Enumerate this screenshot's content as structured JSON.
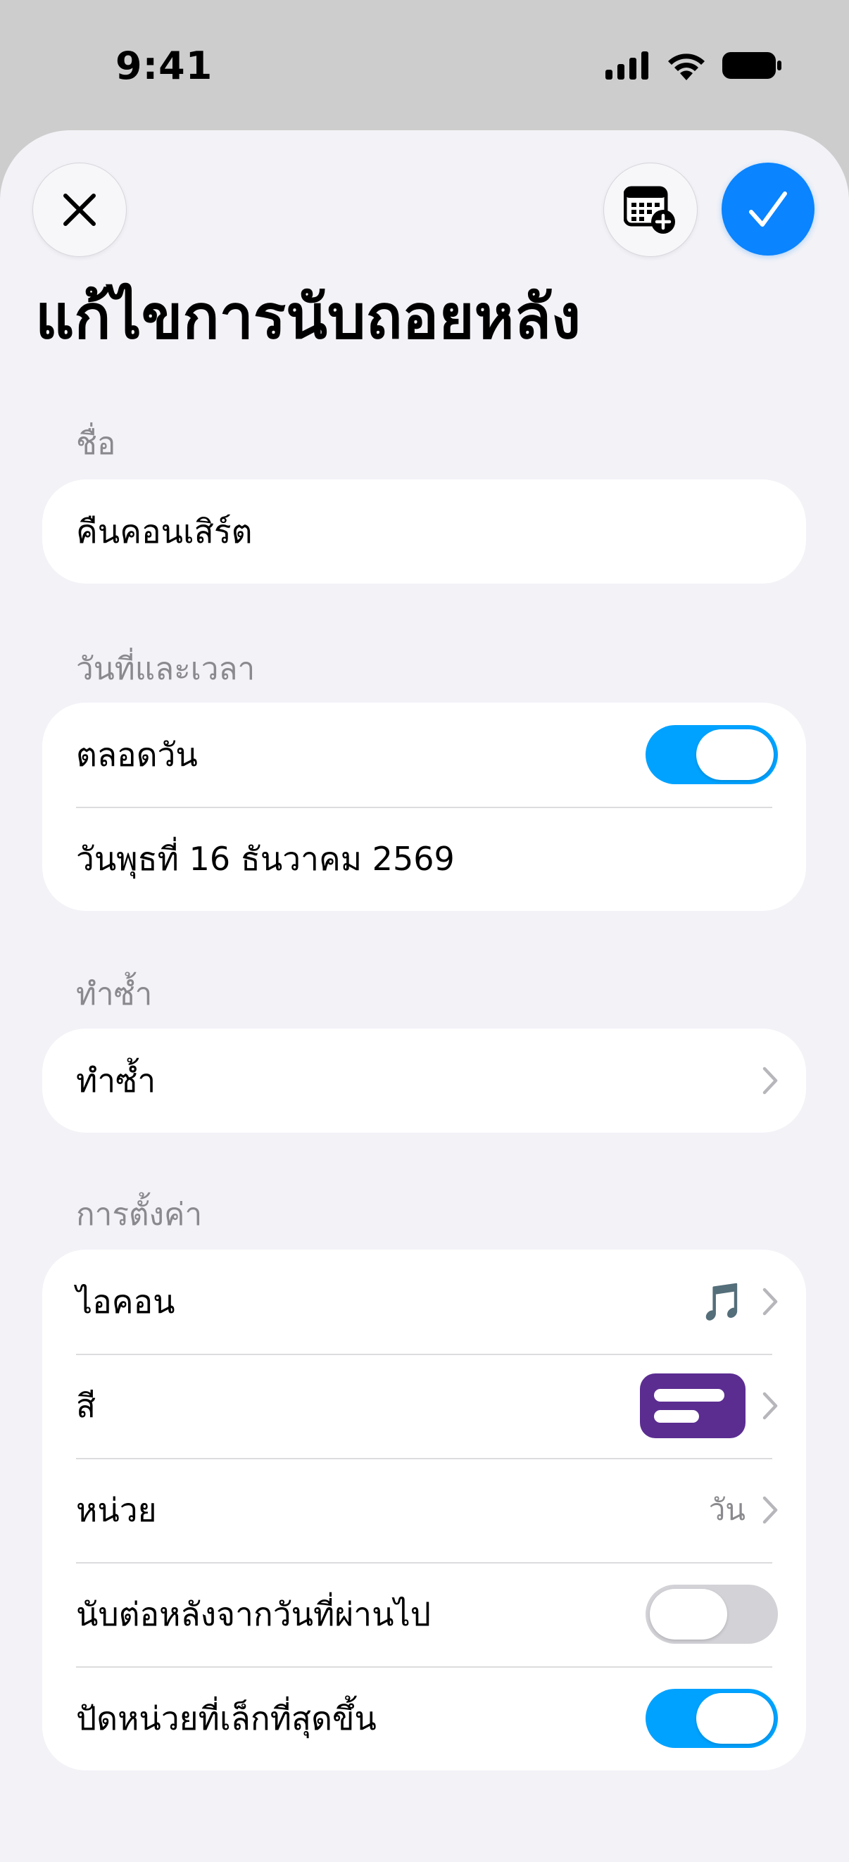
{
  "status_bar": {
    "time": "9:41"
  },
  "header": {
    "title": "แก้ไขการนับถอยหลัง"
  },
  "sections": {
    "name": {
      "label": "ชื่อ",
      "value": "คืนคอนเสิร์ต"
    },
    "datetime": {
      "label": "วันที่และเวลา",
      "all_day_label": "ตลอดวัน",
      "all_day_on": true,
      "date_text": "วันพุธที่ 16 ธันวาคม 2569"
    },
    "repeat": {
      "label": "ทำซ้ำ",
      "row_label": "ทำซ้ำ"
    },
    "settings": {
      "label": "การตั้งค่า",
      "icon_label": "ไอคอน",
      "icon_value": "🎵",
      "color_label": "สี",
      "color_hex": "#5b2d91",
      "unit_label": "หน่วย",
      "unit_value": "วัน",
      "count_up_label": "นับต่อหลังจากวันที่ผ่านไป",
      "count_up_on": false,
      "round_label": "ปัดหน่วยที่เล็กที่สุดขึ้น",
      "round_on": true
    }
  },
  "colors": {
    "accent": "#0a84ff",
    "toggle_on": "#00a2ff",
    "background": "#f2f2f7"
  }
}
